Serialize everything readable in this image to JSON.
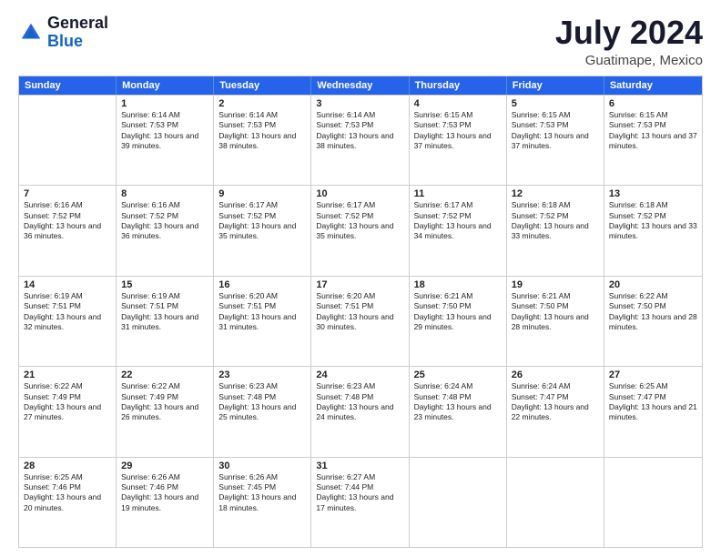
{
  "logo": {
    "general": "General",
    "blue": "Blue"
  },
  "title": {
    "month": "July 2024",
    "location": "Guatimape, Mexico"
  },
  "header": {
    "days": [
      "Sunday",
      "Monday",
      "Tuesday",
      "Wednesday",
      "Thursday",
      "Friday",
      "Saturday"
    ]
  },
  "weeks": [
    [
      {
        "date": "",
        "sunrise": "",
        "sunset": "",
        "daylight": ""
      },
      {
        "date": "1",
        "sunrise": "Sunrise: 6:14 AM",
        "sunset": "Sunset: 7:53 PM",
        "daylight": "Daylight: 13 hours and 39 minutes."
      },
      {
        "date": "2",
        "sunrise": "Sunrise: 6:14 AM",
        "sunset": "Sunset: 7:53 PM",
        "daylight": "Daylight: 13 hours and 38 minutes."
      },
      {
        "date": "3",
        "sunrise": "Sunrise: 6:14 AM",
        "sunset": "Sunset: 7:53 PM",
        "daylight": "Daylight: 13 hours and 38 minutes."
      },
      {
        "date": "4",
        "sunrise": "Sunrise: 6:15 AM",
        "sunset": "Sunset: 7:53 PM",
        "daylight": "Daylight: 13 hours and 37 minutes."
      },
      {
        "date": "5",
        "sunrise": "Sunrise: 6:15 AM",
        "sunset": "Sunset: 7:53 PM",
        "daylight": "Daylight: 13 hours and 37 minutes."
      },
      {
        "date": "6",
        "sunrise": "Sunrise: 6:15 AM",
        "sunset": "Sunset: 7:53 PM",
        "daylight": "Daylight: 13 hours and 37 minutes."
      }
    ],
    [
      {
        "date": "7",
        "sunrise": "Sunrise: 6:16 AM",
        "sunset": "Sunset: 7:52 PM",
        "daylight": "Daylight: 13 hours and 36 minutes."
      },
      {
        "date": "8",
        "sunrise": "Sunrise: 6:16 AM",
        "sunset": "Sunset: 7:52 PM",
        "daylight": "Daylight: 13 hours and 36 minutes."
      },
      {
        "date": "9",
        "sunrise": "Sunrise: 6:17 AM",
        "sunset": "Sunset: 7:52 PM",
        "daylight": "Daylight: 13 hours and 35 minutes."
      },
      {
        "date": "10",
        "sunrise": "Sunrise: 6:17 AM",
        "sunset": "Sunset: 7:52 PM",
        "daylight": "Daylight: 13 hours and 35 minutes."
      },
      {
        "date": "11",
        "sunrise": "Sunrise: 6:17 AM",
        "sunset": "Sunset: 7:52 PM",
        "daylight": "Daylight: 13 hours and 34 minutes."
      },
      {
        "date": "12",
        "sunrise": "Sunrise: 6:18 AM",
        "sunset": "Sunset: 7:52 PM",
        "daylight": "Daylight: 13 hours and 33 minutes."
      },
      {
        "date": "13",
        "sunrise": "Sunrise: 6:18 AM",
        "sunset": "Sunset: 7:52 PM",
        "daylight": "Daylight: 13 hours and 33 minutes."
      }
    ],
    [
      {
        "date": "14",
        "sunrise": "Sunrise: 6:19 AM",
        "sunset": "Sunset: 7:51 PM",
        "daylight": "Daylight: 13 hours and 32 minutes."
      },
      {
        "date": "15",
        "sunrise": "Sunrise: 6:19 AM",
        "sunset": "Sunset: 7:51 PM",
        "daylight": "Daylight: 13 hours and 31 minutes."
      },
      {
        "date": "16",
        "sunrise": "Sunrise: 6:20 AM",
        "sunset": "Sunset: 7:51 PM",
        "daylight": "Daylight: 13 hours and 31 minutes."
      },
      {
        "date": "17",
        "sunrise": "Sunrise: 6:20 AM",
        "sunset": "Sunset: 7:51 PM",
        "daylight": "Daylight: 13 hours and 30 minutes."
      },
      {
        "date": "18",
        "sunrise": "Sunrise: 6:21 AM",
        "sunset": "Sunset: 7:50 PM",
        "daylight": "Daylight: 13 hours and 29 minutes."
      },
      {
        "date": "19",
        "sunrise": "Sunrise: 6:21 AM",
        "sunset": "Sunset: 7:50 PM",
        "daylight": "Daylight: 13 hours and 28 minutes."
      },
      {
        "date": "20",
        "sunrise": "Sunrise: 6:22 AM",
        "sunset": "Sunset: 7:50 PM",
        "daylight": "Daylight: 13 hours and 28 minutes."
      }
    ],
    [
      {
        "date": "21",
        "sunrise": "Sunrise: 6:22 AM",
        "sunset": "Sunset: 7:49 PM",
        "daylight": "Daylight: 13 hours and 27 minutes."
      },
      {
        "date": "22",
        "sunrise": "Sunrise: 6:22 AM",
        "sunset": "Sunset: 7:49 PM",
        "daylight": "Daylight: 13 hours and 26 minutes."
      },
      {
        "date": "23",
        "sunrise": "Sunrise: 6:23 AM",
        "sunset": "Sunset: 7:48 PM",
        "daylight": "Daylight: 13 hours and 25 minutes."
      },
      {
        "date": "24",
        "sunrise": "Sunrise: 6:23 AM",
        "sunset": "Sunset: 7:48 PM",
        "daylight": "Daylight: 13 hours and 24 minutes."
      },
      {
        "date": "25",
        "sunrise": "Sunrise: 6:24 AM",
        "sunset": "Sunset: 7:48 PM",
        "daylight": "Daylight: 13 hours and 23 minutes."
      },
      {
        "date": "26",
        "sunrise": "Sunrise: 6:24 AM",
        "sunset": "Sunset: 7:47 PM",
        "daylight": "Daylight: 13 hours and 22 minutes."
      },
      {
        "date": "27",
        "sunrise": "Sunrise: 6:25 AM",
        "sunset": "Sunset: 7:47 PM",
        "daylight": "Daylight: 13 hours and 21 minutes."
      }
    ],
    [
      {
        "date": "28",
        "sunrise": "Sunrise: 6:25 AM",
        "sunset": "Sunset: 7:46 PM",
        "daylight": "Daylight: 13 hours and 20 minutes."
      },
      {
        "date": "29",
        "sunrise": "Sunrise: 6:26 AM",
        "sunset": "Sunset: 7:46 PM",
        "daylight": "Daylight: 13 hours and 19 minutes."
      },
      {
        "date": "30",
        "sunrise": "Sunrise: 6:26 AM",
        "sunset": "Sunset: 7:45 PM",
        "daylight": "Daylight: 13 hours and 18 minutes."
      },
      {
        "date": "31",
        "sunrise": "Sunrise: 6:27 AM",
        "sunset": "Sunset: 7:44 PM",
        "daylight": "Daylight: 13 hours and 17 minutes."
      },
      {
        "date": "",
        "sunrise": "",
        "sunset": "",
        "daylight": ""
      },
      {
        "date": "",
        "sunrise": "",
        "sunset": "",
        "daylight": ""
      },
      {
        "date": "",
        "sunrise": "",
        "sunset": "",
        "daylight": ""
      }
    ]
  ]
}
